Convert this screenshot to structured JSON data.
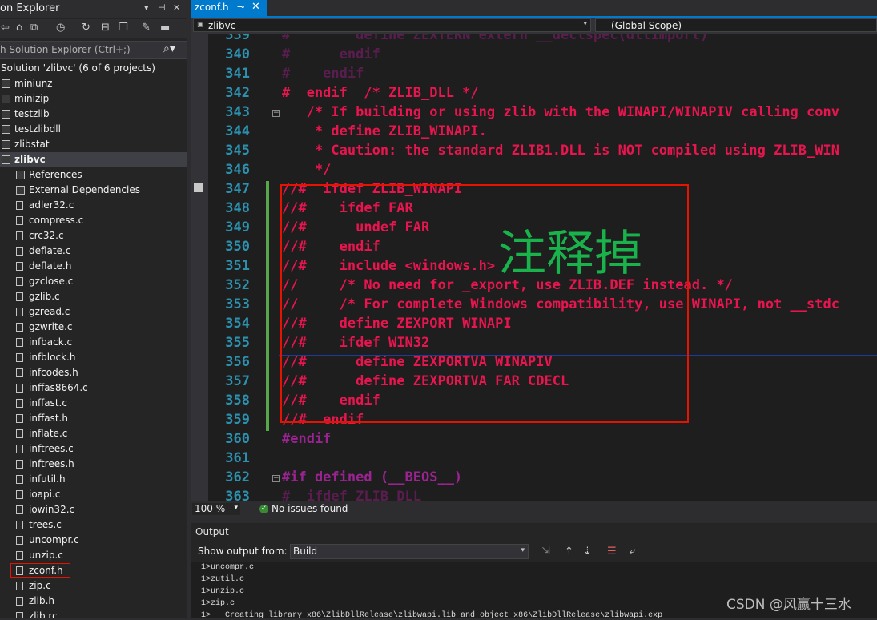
{
  "solution_explorer": {
    "title": "on Explorer",
    "title_controls": [
      "▾",
      "⊣",
      "✕"
    ],
    "search_placeholder": "h Solution Explorer (Ctrl+;)",
    "solution_label": "Solution 'zlibvc' (6 of 6 projects)",
    "projects": [
      "miniunz",
      "minizip",
      "testzlib",
      "testzlibdll",
      "zlibstat",
      "zlibvc"
    ],
    "selected_project": "zlibvc",
    "children": [
      "References",
      "External Dependencies"
    ],
    "files": [
      "adler32.c",
      "compress.c",
      "crc32.c",
      "deflate.c",
      "deflate.h",
      "gzclose.c",
      "gzlib.c",
      "gzread.c",
      "gzwrite.c",
      "infback.c",
      "infblock.h",
      "infcodes.h",
      "inffas8664.c",
      "inffast.c",
      "inffast.h",
      "inflate.c",
      "inftrees.c",
      "inftrees.h",
      "infutil.h",
      "ioapi.c",
      "iowin32.c",
      "trees.c",
      "uncompr.c",
      "unzip.c",
      "zconf.h",
      "zip.c",
      "zlib.h",
      "zlib.rc"
    ],
    "highlighted_file": "zconf.h"
  },
  "editor": {
    "tab_name": "zconf.h",
    "project_dropdown": "zlibvc",
    "scope_dropdown": "(Global Scope)",
    "lines": [
      {
        "n": "339",
        "text": "#        define ZEXTERN extern __declspec(dllimport)",
        "cls": "c-dim"
      },
      {
        "n": "340",
        "text": "#      endif",
        "cls": "c-dim"
      },
      {
        "n": "341",
        "text": "#    endif",
        "cls": "c-dim"
      },
      {
        "n": "342",
        "text": "#  endif  /* ZLIB_DLL */",
        "cls": "c-com"
      },
      {
        "n": "343",
        "text": "   /* If building or using zlib with the WINAPI/WINAPIV calling conv",
        "cls": "c-com"
      },
      {
        "n": "344",
        "text": "    * define ZLIB_WINAPI.",
        "cls": "c-com"
      },
      {
        "n": "345",
        "text": "    * Caution: the standard ZLIB1.DLL is NOT compiled using ZLIB_WIN",
        "cls": "c-com"
      },
      {
        "n": "346",
        "text": "    */",
        "cls": "c-com"
      },
      {
        "n": "347",
        "text": "//#  ifdef ZLIB_WINAPI",
        "cls": "c-com"
      },
      {
        "n": "348",
        "text": "//#    ifdef FAR",
        "cls": "c-com"
      },
      {
        "n": "349",
        "text": "//#      undef FAR",
        "cls": "c-com"
      },
      {
        "n": "350",
        "text": "//#    endif",
        "cls": "c-com"
      },
      {
        "n": "351",
        "text": "//#    include <windows.h>",
        "cls": "c-com"
      },
      {
        "n": "352",
        "text": "//     /* No need for _export, use ZLIB.DEF instead. */",
        "cls": "c-com"
      },
      {
        "n": "353",
        "text": "//     /* For complete Windows compatibility, use WINAPI, not __stdc",
        "cls": "c-com"
      },
      {
        "n": "354",
        "text": "//#    define ZEXPORT WINAPI",
        "cls": "c-com"
      },
      {
        "n": "355",
        "text": "//#    ifdef WIN32",
        "cls": "c-com"
      },
      {
        "n": "356",
        "text": "//#      define ZEXPORTVA WINAPIV",
        "cls": "c-com"
      },
      {
        "n": "357",
        "text": "//#      define ZEXPORTVA FAR CDECL",
        "cls": "c-com"
      },
      {
        "n": "358",
        "text": "//#    endif",
        "cls": "c-com"
      },
      {
        "n": "359",
        "text": "//#  endif",
        "cls": "c-com"
      },
      {
        "n": "360",
        "text": "#endif",
        "cls": "c-pp"
      },
      {
        "n": "361",
        "text": "",
        "cls": "c-com"
      },
      {
        "n": "362",
        "text": "#if defined (__BEOS__)",
        "cls": "c-pp"
      },
      {
        "n": "363",
        "text": "#  ifdef ZLIB_DLL",
        "cls": "c-dim"
      }
    ],
    "annotation": "注释掉",
    "zoom": "100 %",
    "status": "No issues found"
  },
  "output": {
    "title": "Output",
    "show_label": "Show output from:",
    "source": "Build",
    "lines": [
      "1>uncompr.c",
      "1>zutil.c",
      "1>unzip.c",
      "1>zip.c",
      "1>   Creating library x86\\ZlibDllRelease\\zlibwapi.lib and object x86\\ZlibDllRelease\\zlibwapi.exp"
    ]
  },
  "watermark": "CSDN @风赢十三水"
}
